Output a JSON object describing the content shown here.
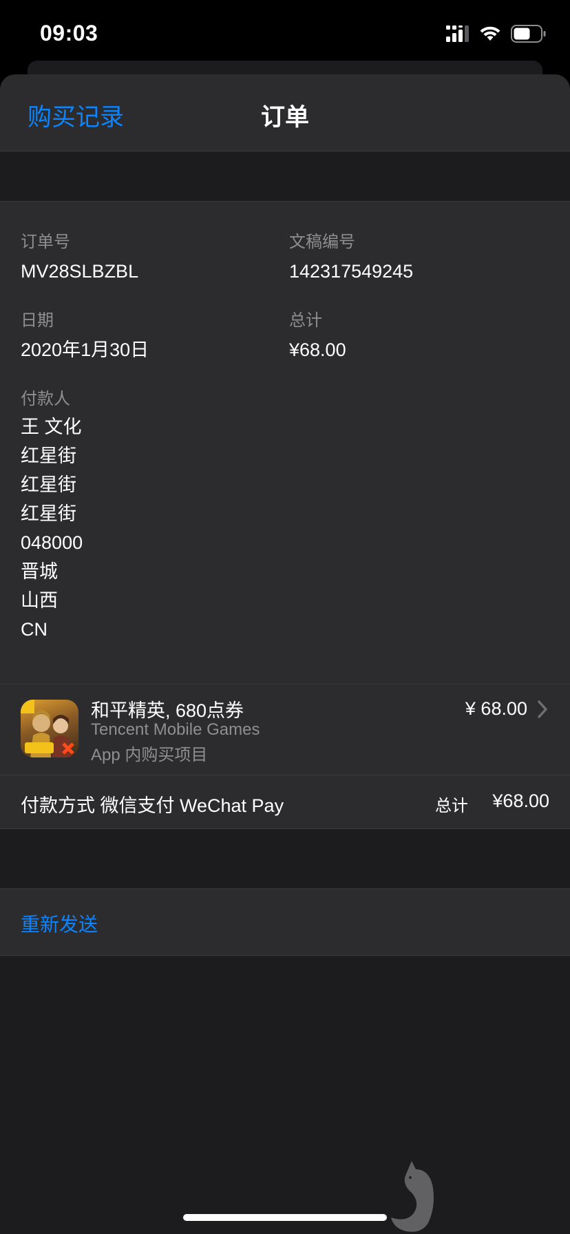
{
  "status_bar": {
    "time": "09:03"
  },
  "nav": {
    "back_label": "购买记录",
    "title": "订单"
  },
  "order": {
    "order_no_label": "订单号",
    "order_no": "MV28SLBZBL",
    "doc_no_label": "文稿编号",
    "doc_no": "142317549245",
    "date_label": "日期",
    "date": "2020年1月30日",
    "total_label": "总计",
    "total": "¥68.00",
    "payer_label": "付款人",
    "payer_lines": [
      "王 文化",
      "红星街",
      "红星街",
      "红星街",
      "048000",
      "晋城",
      "山西",
      "CN"
    ]
  },
  "item": {
    "title": "和平精英, 680点券",
    "developer": "Tencent Mobile Games",
    "type": "App 内购买项目",
    "price": "¥ 68.00",
    "icon": "game-app-icon"
  },
  "payment": {
    "method": "付款方式 微信支付 WeChat Pay",
    "total_label": "总计",
    "total": "¥68.00"
  },
  "actions": {
    "resend_label": "重新发送"
  },
  "colors": {
    "accent": "#0a84ff",
    "card_bg": "#2c2c2e",
    "page_bg": "#1c1c1e",
    "secondary_text": "#8e8e93"
  }
}
